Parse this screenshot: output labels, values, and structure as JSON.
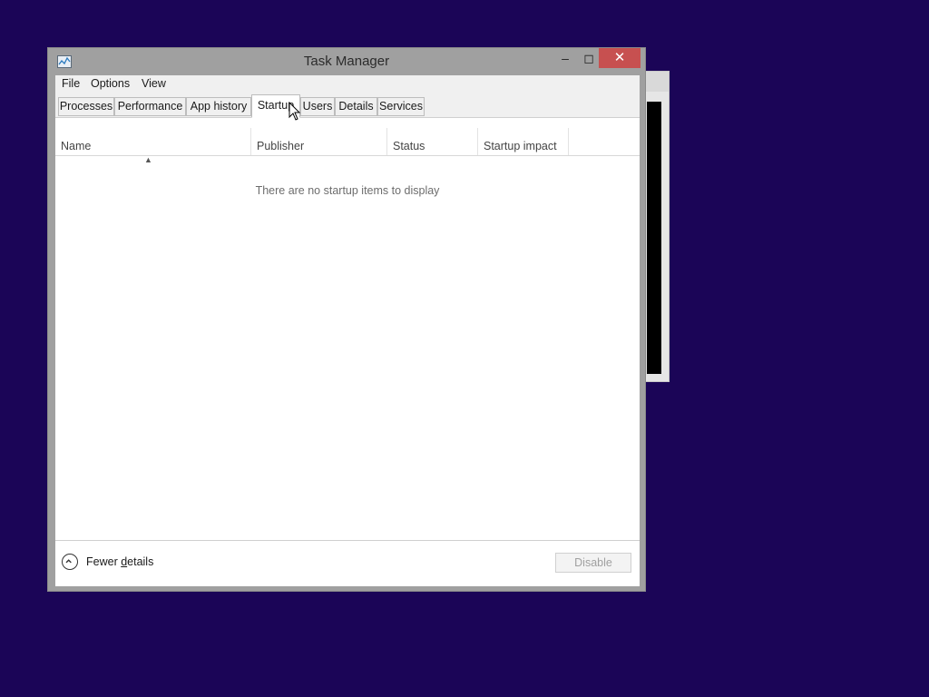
{
  "window": {
    "title": "Task Manager"
  },
  "menu": {
    "items": [
      "File",
      "Options",
      "View"
    ]
  },
  "tabs": [
    {
      "label": "Processes"
    },
    {
      "label": "Performance"
    },
    {
      "label": "App history"
    },
    {
      "label": "Startup",
      "active": true
    },
    {
      "label": "Users"
    },
    {
      "label": "Details"
    },
    {
      "label": "Services"
    }
  ],
  "columns": [
    "Name",
    "Publisher",
    "Status",
    "Startup impact"
  ],
  "sort": {
    "column": "Name",
    "direction": "ascending"
  },
  "empty_message": "There are no startup items to display",
  "footer": {
    "fewer_details_prefix": "Fewer ",
    "fewer_details_underlined": "d",
    "fewer_details_suffix": "etails",
    "disable_label": "Disable"
  },
  "icons": {
    "app": "task-manager-icon",
    "collapse": "chevron-up-circle-icon",
    "sort": "sort-ascending-icon"
  },
  "colors": {
    "desktop": "#1b0557",
    "close_button": "#c75050"
  }
}
